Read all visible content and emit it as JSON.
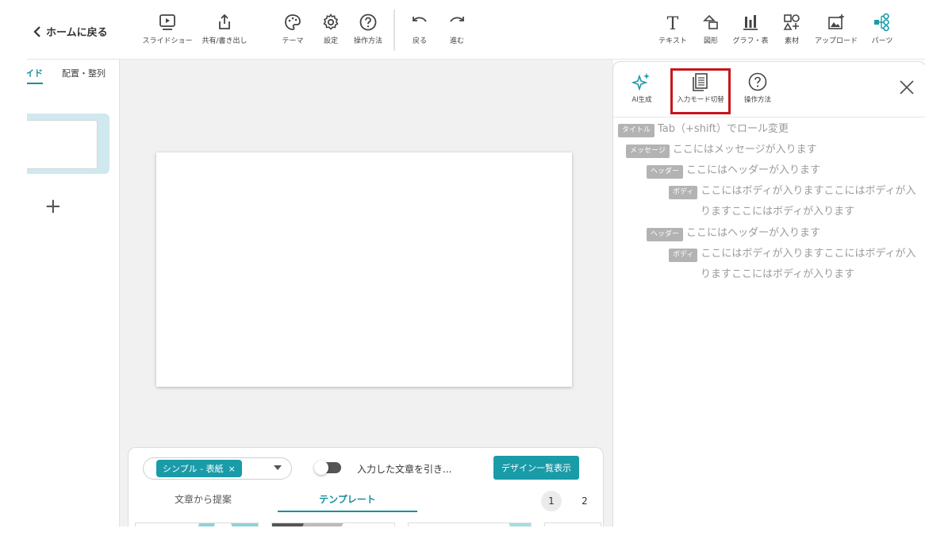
{
  "toolbar": {
    "back_label": "ホームに戻る",
    "buttons": {
      "slideshow": "スライドショー",
      "share": "共有/書き出し",
      "theme": "テーマ",
      "settings": "設定",
      "help": "操作方法",
      "undo": "戻る",
      "redo": "進む",
      "text": "テキスト",
      "shape": "図形",
      "chart": "グラフ・表",
      "material": "素材",
      "upload": "アップロード",
      "parts": "パーツ"
    }
  },
  "left_panel": {
    "tab_slides": "イド",
    "tab_arrange": "配置・整列",
    "add_symbol": "+"
  },
  "bottom_panel": {
    "selected_chip": "シンプル - 表紙",
    "chip_close": "×",
    "toggle_label": "入力した文章を引き...",
    "design_button": "デザイン一覧表示",
    "tab_suggest": "文章から提案",
    "tab_template": "テンプレート",
    "pages": [
      "1",
      "2"
    ]
  },
  "right_panel": {
    "ai_label": "AI生成",
    "input_mode_label": "入力モード切替",
    "help_label": "操作方法",
    "outline": [
      {
        "tag": "タイトル",
        "text": "Tab（+shift）でロール変更",
        "level": 0
      },
      {
        "tag": "メッセージ",
        "text": "ここにはメッセージが入ります",
        "level": 1
      },
      {
        "tag": "ヘッダー",
        "text": "ここにはヘッダーが入ります",
        "level": 2
      },
      {
        "tag": "ボディ",
        "text": "ここにはボディが入りますここにはボディが入",
        "text2": "りますここにはボディが入ります",
        "level": 3
      },
      {
        "tag": "ヘッダー",
        "text": "ここにはヘッダーが入ります",
        "level": 2
      },
      {
        "tag": "ボディ",
        "text": "ここにはボディが入りますここにはボディが入",
        "text2": "りますここにはボディが入ります",
        "level": 3
      }
    ]
  },
  "colors": {
    "accent": "#1a9ba8",
    "highlight_border": "#c8161d",
    "tag_bg": "#b3b3b3"
  }
}
